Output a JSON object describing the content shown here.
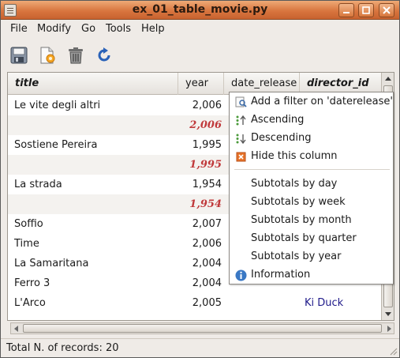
{
  "window": {
    "title": "ex_01_table_movie.py"
  },
  "menubar": {
    "items": [
      "File",
      "Modify",
      "Go",
      "Tools",
      "Help"
    ]
  },
  "toolbar": {
    "buttons": [
      "save-icon",
      "new-record-icon",
      "delete-icon",
      "refresh-icon"
    ]
  },
  "table": {
    "columns": [
      "title",
      "year",
      "date_release",
      "director_id"
    ],
    "rows": [
      {
        "title": "Le vite degli altri",
        "year": "2,006",
        "date": "",
        "director": ""
      },
      {
        "title": "",
        "year": "2,006",
        "date": "",
        "director": "",
        "subtotal": true
      },
      {
        "title": "Sostiene Pereira",
        "year": "1,995",
        "date": "",
        "director": ""
      },
      {
        "title": "",
        "year": "1,995",
        "date": "",
        "director": "",
        "subtotal": true
      },
      {
        "title": "La strada",
        "year": "1,954",
        "date": "",
        "director": ""
      },
      {
        "title": "",
        "year": "1,954",
        "date": "",
        "director": "",
        "subtotal": true
      },
      {
        "title": "Soffio",
        "year": "2,007",
        "date": "",
        "director": ""
      },
      {
        "title": "Time",
        "year": "2,006",
        "date": "",
        "director": ""
      },
      {
        "title": "La Samaritana",
        "year": "2,004",
        "date": "",
        "director": ""
      },
      {
        "title": "Ferro 3",
        "year": "2,004",
        "date": "",
        "director": ""
      },
      {
        "title": "L'Arco",
        "year": "2,005",
        "date": "",
        "director": "Ki Duck"
      }
    ]
  },
  "context_menu": {
    "items": [
      {
        "label": "Add a filter on 'daterelease'",
        "icon": "filter-icon"
      },
      {
        "label": "Ascending",
        "icon": "sort-ascending-icon"
      },
      {
        "label": "Descending",
        "icon": "sort-descending-icon"
      },
      {
        "label": "Hide this column",
        "icon": "hide-column-icon"
      },
      {
        "label": "Subtotals by day",
        "icon": ""
      },
      {
        "label": "Subtotals by week",
        "icon": ""
      },
      {
        "label": "Subtotals by month",
        "icon": ""
      },
      {
        "label": "Subtotals by quarter",
        "icon": ""
      },
      {
        "label": "Subtotals by year",
        "icon": ""
      },
      {
        "label": "Information",
        "icon": "information-icon"
      }
    ]
  },
  "status": {
    "text": "Total N. of records: 20"
  },
  "colors": {
    "titlebar": "#d9763f",
    "subtotal_text": "#c0393b",
    "director_link": "#1f1a8a",
    "info_icon": "#3a78c4"
  }
}
